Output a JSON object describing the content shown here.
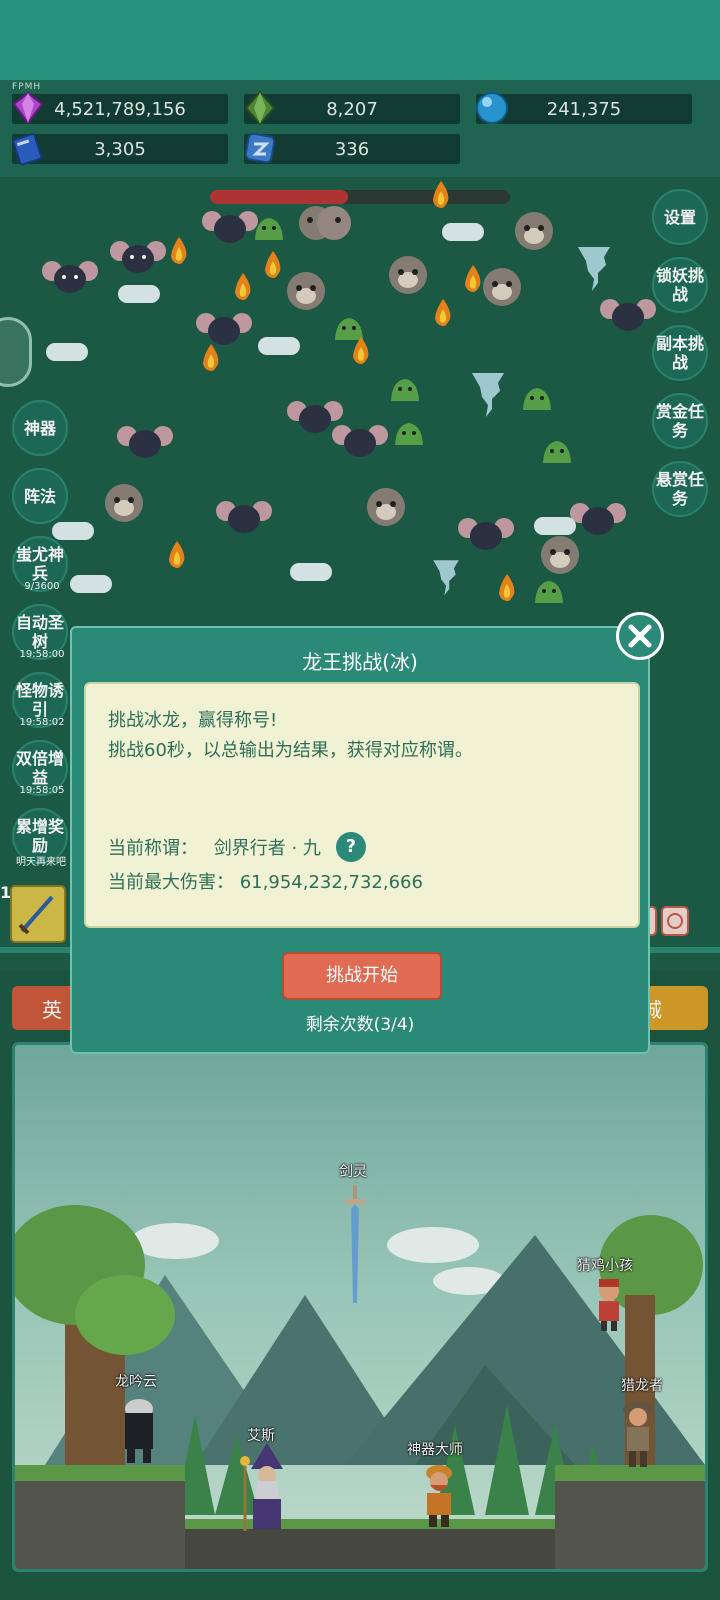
{
  "resources": {
    "header": "FPMH",
    "items": [
      {
        "icon": "purple-gem-icon",
        "value": "4,521,789,156"
      },
      {
        "icon": "green-crystal-icon",
        "value": "8,207"
      },
      {
        "icon": "blue-orb-icon",
        "value": "241,375"
      },
      {
        "icon": "blue-book-icon",
        "value": "3,305"
      },
      {
        "icon": "blue-rune-icon",
        "value": "336"
      }
    ]
  },
  "boss": {
    "health_fraction": 0.46
  },
  "right_menu": [
    "设置",
    "锁妖挑战",
    "副本挑战",
    "赏金任务",
    "悬赏任务"
  ],
  "left_menu": {
    "artifact": "神器",
    "formation": "阵法",
    "chiyou": "蚩尤神兵",
    "chiyou_count": "9/3600",
    "auto_tree": "自动圣树",
    "auto_tree_timer": "19:58:00",
    "lure": "怪物诱引",
    "lure_timer": "19:58:02",
    "double": "双倍增益",
    "double_timer": "19:58:05",
    "reward": "累增奖励",
    "reward_note": "明天再来吧"
  },
  "weapon_slot": {
    "level": "103"
  },
  "bottom_nav": {
    "hero": "英",
    "city": "城"
  },
  "scene": {
    "characters": [
      "剑灵",
      "猜鸡小孩",
      "龙吟云",
      "猎龙者",
      "艾斯",
      "神器大师"
    ]
  },
  "modal": {
    "title": "龙王挑战(冰)",
    "desc1": "挑战冰龙，赢得称号!",
    "desc2": "挑战60秒，以总输出为结果，获得对应称谓。",
    "current_title_label": "当前称谓：",
    "current_title_value": "剑界行者 · 九",
    "help": "?",
    "max_damage_label": "当前最大伤害：",
    "max_damage_value": "61,954,232,732,666",
    "start_button": "挑战开始",
    "remaining": "剩余次数(3/4)"
  },
  "colors": {
    "accent": "#2b8a77",
    "start_button": "#e06a52",
    "panel": "#f0f2d3"
  }
}
